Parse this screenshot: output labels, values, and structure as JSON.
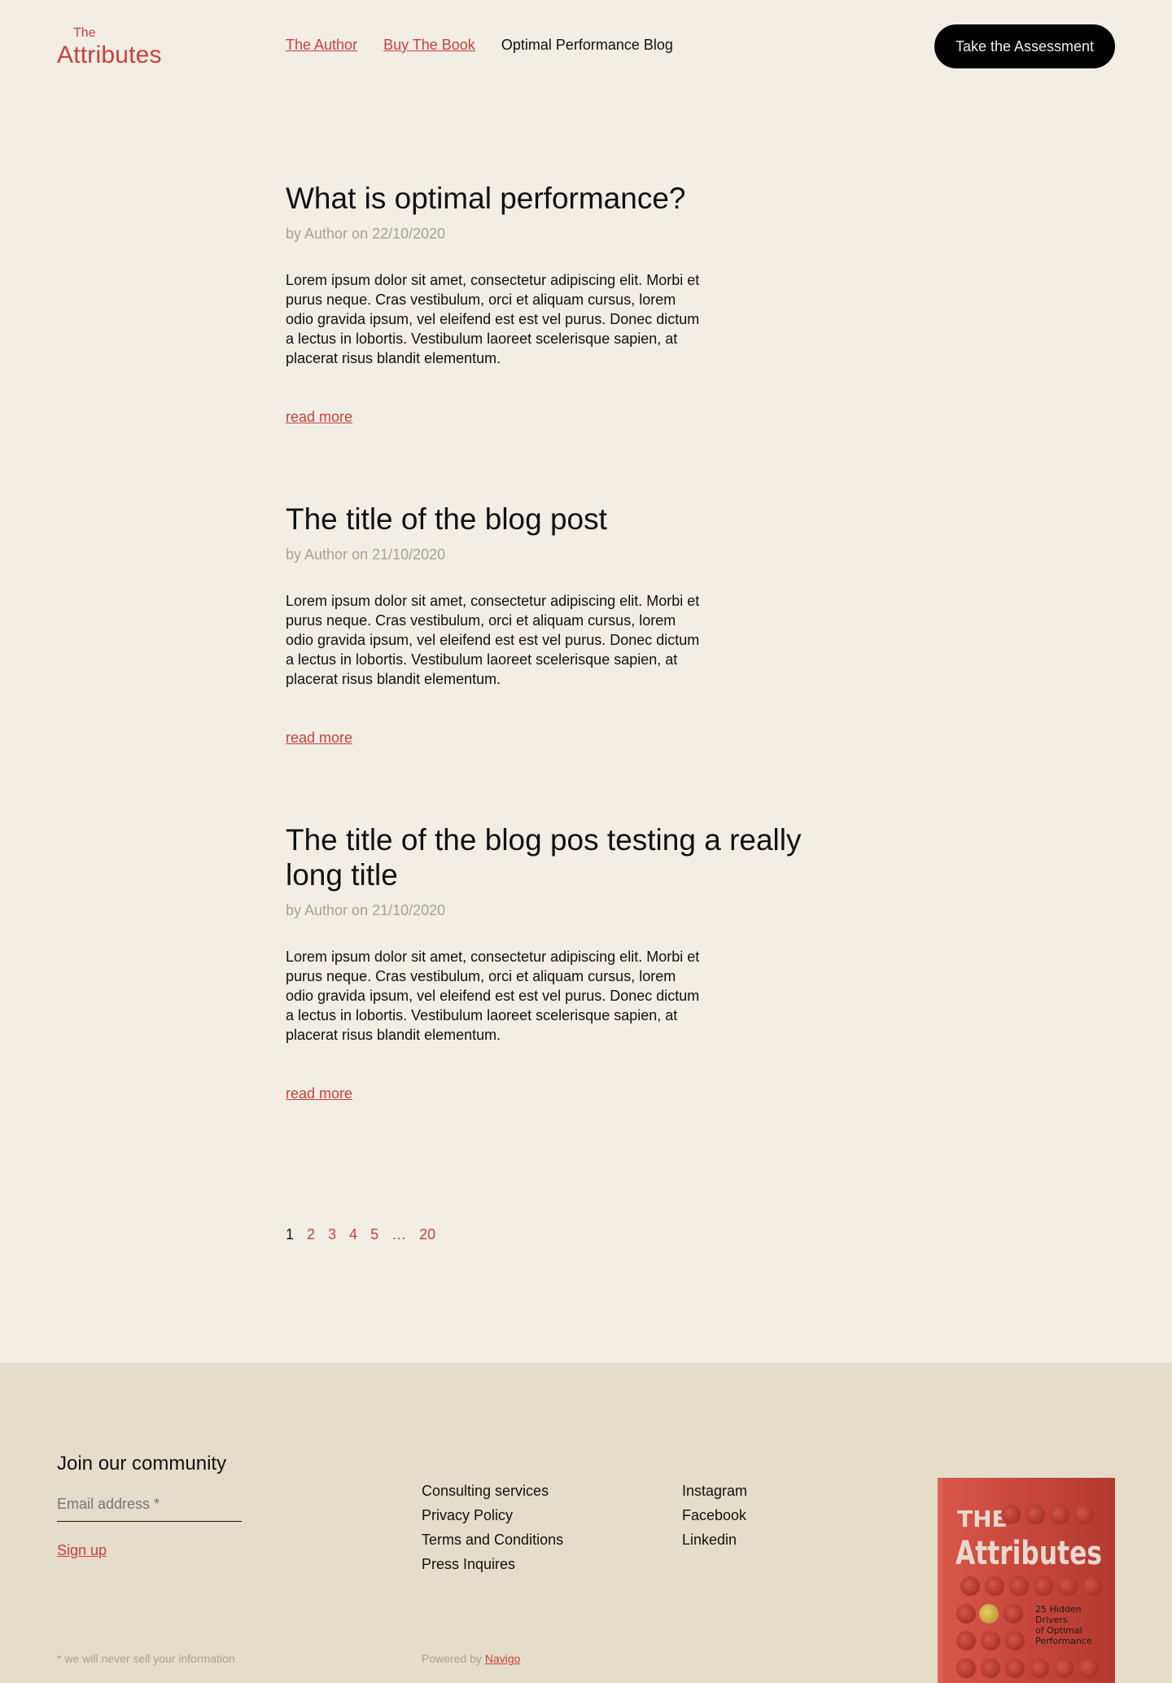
{
  "header": {
    "logo_small": "The",
    "logo_big": "Attributes",
    "nav": [
      {
        "label": "The Author"
      },
      {
        "label": "Buy The Book"
      },
      {
        "label": "Optimal Performance Blog"
      }
    ],
    "cta_label": "Take the Assessment"
  },
  "posts": [
    {
      "title": "What is optimal performance?",
      "meta": "by Author on 22/10/2020",
      "excerpt": "Lorem ipsum dolor sit amet, consectetur adipiscing elit. Morbi et purus neque. Cras vestibulum, orci et aliquam cursus, lorem odio gravida ipsum, vel eleifend est est vel purus. Donec dictum a lectus in lobortis. Vestibulum laoreet scelerisque sapien, at placerat risus blandit elementum.",
      "read_more": "read more"
    },
    {
      "title": "The title of the blog post",
      "meta": "by Author on 21/10/2020",
      "excerpt": "Lorem ipsum dolor sit amet, consectetur adipiscing elit. Morbi et purus neque. Cras vestibulum, orci et aliquam cursus, lorem odio gravida ipsum, vel eleifend est est vel purus. Donec dictum a lectus in lobortis. Vestibulum laoreet scelerisque sapien, at placerat risus blandit elementum.",
      "read_more": "read more"
    },
    {
      "title": "The title of the blog pos testing a really long title",
      "meta": "by Author on 21/10/2020",
      "excerpt": "Lorem ipsum dolor sit amet, consectetur adipiscing elit. Morbi et purus neque. Cras vestibulum, orci et aliquam cursus, lorem odio gravida ipsum, vel eleifend est est vel purus. Donec dictum a lectus in lobortis. Vestibulum laoreet scelerisque sapien, at placerat risus blandit elementum.",
      "read_more": "read more"
    }
  ],
  "pagination": {
    "current": "1",
    "pages": [
      "2",
      "3",
      "4",
      "5",
      "…",
      "20"
    ]
  },
  "footer": {
    "join_title": "Join our community",
    "email_placeholder": "Email address *",
    "signup_label": "Sign up",
    "privacy_note": "* we will never sell your information",
    "links_col1": [
      "Consulting services",
      "Privacy Policy",
      "Terms and Conditions",
      "Press Inquires"
    ],
    "links_col2": [
      "Instagram",
      "Facebook",
      "Linkedin"
    ],
    "powered_prefix": "Powered by ",
    "powered_link": "Navigo",
    "book": {
      "line1": "THE",
      "line2": "Attributes",
      "subtitle": [
        "25 Hidden",
        "Drivers",
        "of Optimal",
        "Performance"
      ]
    }
  },
  "colors": {
    "background": "#f2ede5",
    "footer_bg": "#e4ddca",
    "accent": "#c8423a",
    "meta": "#a8a48a",
    "text": "#111111"
  }
}
